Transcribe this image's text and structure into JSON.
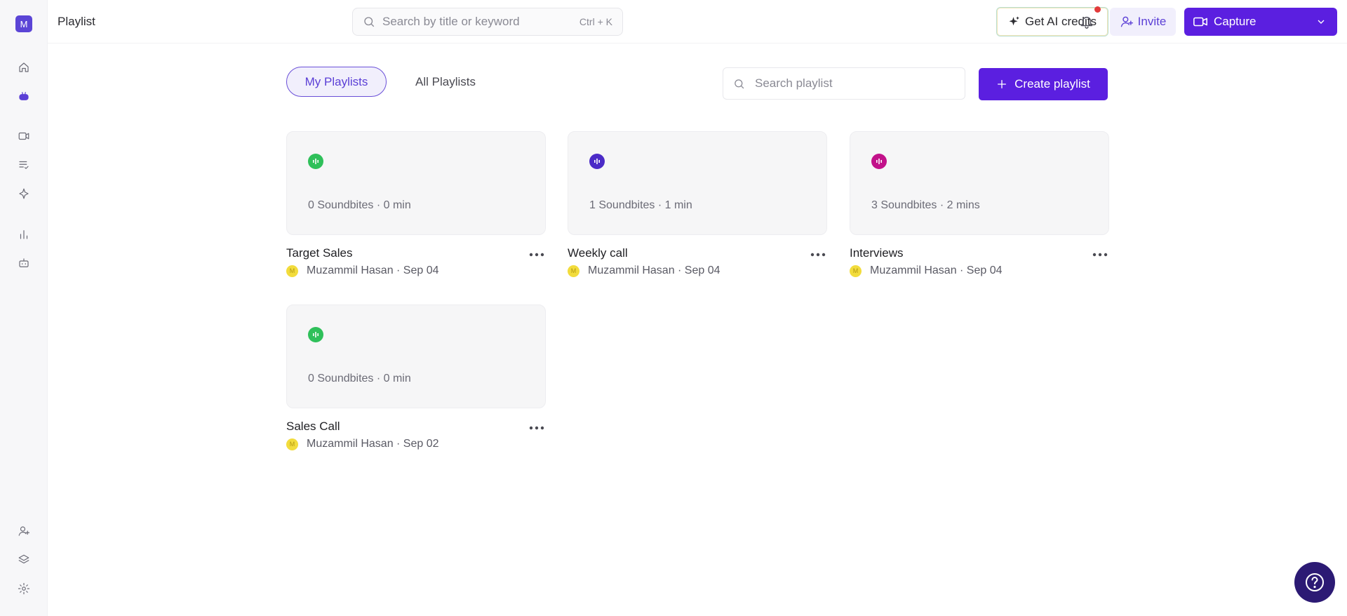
{
  "app": {
    "workspace_initial": "M",
    "page_title": "Playlist"
  },
  "header": {
    "search_placeholder": "Search by title or keyword",
    "search_shortcut": "Ctrl + K",
    "ai_credits_label": "Get AI credits",
    "invite_label": "Invite",
    "capture_label": "Capture"
  },
  "sidebar": {
    "top_icons": [
      "home-icon",
      "bot-icon",
      "video-icon",
      "list-check-icon",
      "sparkle-icon",
      "chart-icon",
      "robot-icon"
    ],
    "bottom_icons": [
      "add-user-icon",
      "layers-icon",
      "settings-icon"
    ]
  },
  "tabs": {
    "my_playlists": "My Playlists",
    "all_playlists": "All Playlists"
  },
  "playlist_search": {
    "placeholder": "Search playlist"
  },
  "create_button": {
    "label": "Create playlist"
  },
  "playlists": [
    {
      "title": "Target Sales",
      "stats": "0 Soundbites · 0 min",
      "owner": "Muzammil Hasan · Sep 04",
      "color": "#2fc05a"
    },
    {
      "title": "Weekly call",
      "stats": "1 Soundbites · 1 min",
      "owner": "Muzammil Hasan · Sep 04",
      "color": "#4b2bc7"
    },
    {
      "title": "Interviews",
      "stats": "3 Soundbites · 2 mins",
      "owner": "Muzammil Hasan · Sep 04",
      "color": "#c2128a"
    },
    {
      "title": "Sales Call",
      "stats": "0 Soundbites · 0 min",
      "owner": "Muzammil Hasan · Sep 02",
      "color": "#2fc05a"
    }
  ],
  "colors": {
    "accent": "#5b1fe0",
    "notification_dot": "#e23b3b",
    "help_button": "#2c1a74"
  }
}
